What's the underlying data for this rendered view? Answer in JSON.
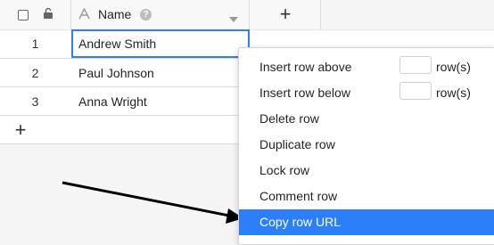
{
  "header": {
    "name_label": "Name",
    "add_column_symbol": "+"
  },
  "rows": [
    {
      "number": "1",
      "name": "Andrew Smith"
    },
    {
      "number": "2",
      "name": "Paul Johnson"
    },
    {
      "number": "3",
      "name": "Anna Wright"
    }
  ],
  "add_row_symbol": "+",
  "context_menu": {
    "insert_above": {
      "label": "Insert row above",
      "value": "",
      "suffix": "row(s)"
    },
    "insert_below": {
      "label": "Insert row below",
      "value": "",
      "suffix": "row(s)"
    },
    "delete": "Delete row",
    "duplicate": "Duplicate row",
    "lock": "Lock row",
    "comment": "Comment row",
    "copy_url": "Copy row URL"
  },
  "colors": {
    "accent": "#2d7ff9",
    "selected_border": "#2d7ff9",
    "grid_line": "#dcdcdc"
  }
}
